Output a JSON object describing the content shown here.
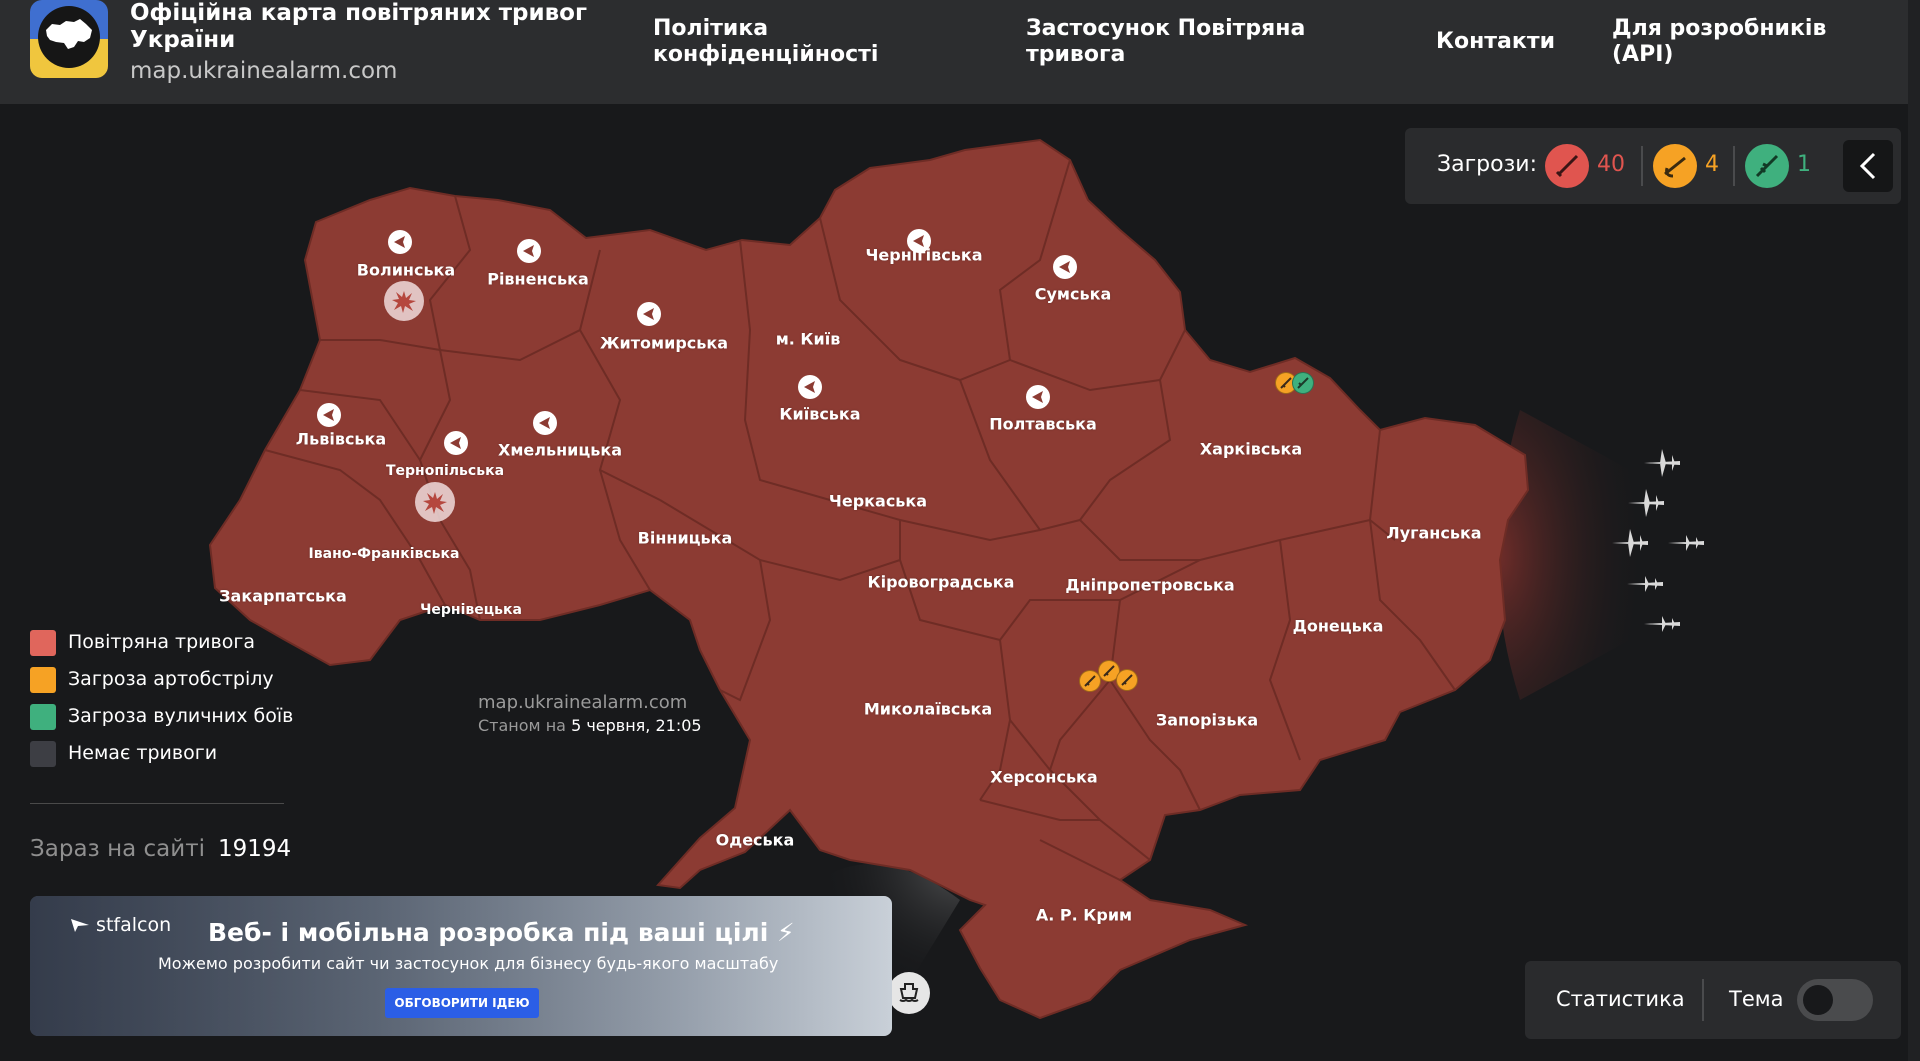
{
  "header": {
    "title": "Офіційна карта повітряних тривог України",
    "url": "map.ukrainealarm.com",
    "nav": {
      "privacy": "Політика конфіденційності",
      "app": "Застосунок Повітряна тривога",
      "contacts": "Контакти",
      "api": "Для розробників (API)"
    }
  },
  "threats": {
    "label": "Загрози:",
    "items": [
      {
        "name": "missile",
        "count": "40",
        "color": "#e0554f"
      },
      {
        "name": "artillery",
        "count": "4",
        "color": "#f6a224"
      },
      {
        "name": "street-fighting",
        "count": "1",
        "color": "#3fb07e"
      }
    ]
  },
  "map": {
    "alarm_color": "#8c3b33",
    "border_color": "#6e2c25",
    "regions": [
      {
        "name": "Волинська",
        "alarm": true
      },
      {
        "name": "Рівненська",
        "alarm": true
      },
      {
        "name": "Житомирська",
        "alarm": true
      },
      {
        "name": "м. Київ",
        "alarm": false
      },
      {
        "name": "Чернігівська",
        "alarm": true
      },
      {
        "name": "Сумська",
        "alarm": true
      },
      {
        "name": "Київська",
        "alarm": true
      },
      {
        "name": "Полтавська",
        "alarm": true
      },
      {
        "name": "Харківська",
        "alarm": false
      },
      {
        "name": "Львівська",
        "alarm": true
      },
      {
        "name": "Тернопільська",
        "alarm": true
      },
      {
        "name": "Хмельницька",
        "alarm": true
      },
      {
        "name": "Черкаська",
        "alarm": false
      },
      {
        "name": "Вінницька",
        "alarm": false
      },
      {
        "name": "Луганська",
        "alarm": false
      },
      {
        "name": "Івано-Франківська",
        "alarm": false
      },
      {
        "name": "Закарпатська",
        "alarm": false
      },
      {
        "name": "Чернівецька",
        "alarm": false
      },
      {
        "name": "Кіровоградська",
        "alarm": false
      },
      {
        "name": "Дніпропетровська",
        "alarm": false
      },
      {
        "name": "Донецька",
        "alarm": false
      },
      {
        "name": "Миколаївська",
        "alarm": false
      },
      {
        "name": "Запорізька",
        "alarm": false
      },
      {
        "name": "Херсонська",
        "alarm": false
      },
      {
        "name": "Одеська",
        "alarm": false
      },
      {
        "name": "А. Р. Крим",
        "alarm": false
      }
    ],
    "watermark": "map.ukrainealarm.com",
    "status_prefix": "Станом на",
    "status_time": "5 червня, 21:05"
  },
  "legend": [
    {
      "label": "Повітряна тривога",
      "color": "#e0665c"
    },
    {
      "label": "Загроза артобстрілу",
      "color": "#f6a224"
    },
    {
      "label": "Загроза вуличних боїв",
      "color": "#3fb07e"
    },
    {
      "label": "Немає тривоги",
      "color": "#3d3e44"
    }
  ],
  "online": {
    "label": "Зараз на сайті",
    "count": "19194"
  },
  "ad": {
    "brand": "stfalcon",
    "title": "Веб- і мобільна розробка під ваші цілі ⚡",
    "subtitle": "Можемо розробити сайт чи застосунок для бізнесу будь-якого масштабу",
    "cta": "ОБГОВОРИТИ ІДЕЮ"
  },
  "controls": {
    "stats": "Статистика",
    "theme": "Тема",
    "theme_dark": false
  }
}
